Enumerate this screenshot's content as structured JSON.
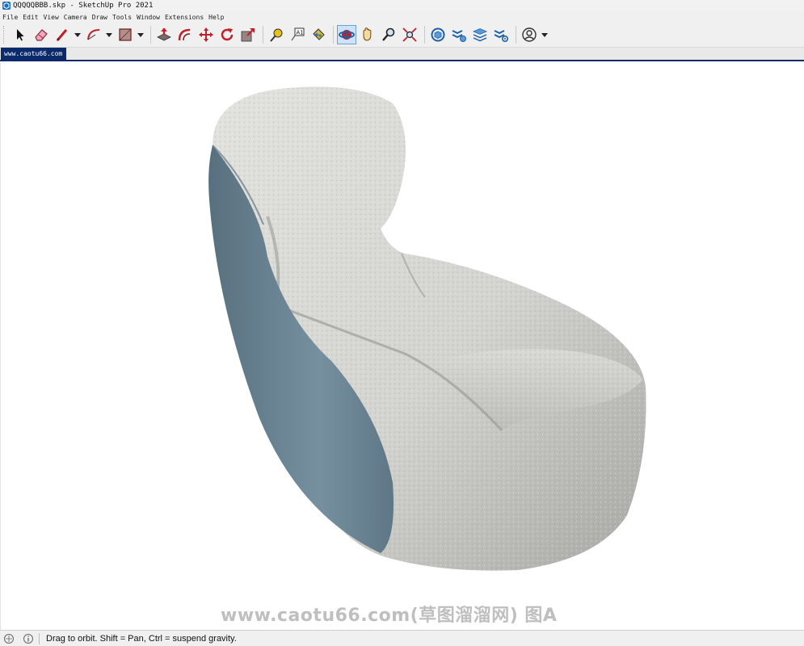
{
  "window": {
    "title": "QQQQQBBB.skp - SketchUp Pro 2021"
  },
  "menu": {
    "items": [
      "File",
      "Edit",
      "View",
      "Camera",
      "Draw",
      "Tools",
      "Window",
      "Extensions",
      "Help"
    ]
  },
  "toolbar": {
    "tools": [
      "select-icon",
      "eraser-icon",
      "line-icon",
      "arc-icon",
      "rectangle-icon",
      "push-pull-icon",
      "offset-icon",
      "move-icon",
      "rotate-icon",
      "scale-icon",
      "tape-measure-icon",
      "text-icon",
      "paint-bucket-icon",
      "orbit-icon",
      "pan-icon",
      "zoom-icon",
      "zoom-extents-icon",
      "3d-warehouse-icon",
      "extension-warehouse-icon",
      "layout-icon",
      "extension-manager-icon",
      "user-account-icon"
    ],
    "active_tool": "orbit-icon"
  },
  "tabs": {
    "active_label": "www.caotu66.com"
  },
  "viewport": {
    "watermark": "www.caotu66.com(草图溜溜网) 图A",
    "model": "lounge-chair",
    "colors": {
      "fabric": "#d6d6d2",
      "fabric_shade": "#a9aaa6",
      "shell": "#6f8795",
      "shell_shade": "#56707e"
    }
  },
  "status": {
    "message": "Drag to orbit. Shift = Pan, Ctrl = suspend gravity."
  }
}
